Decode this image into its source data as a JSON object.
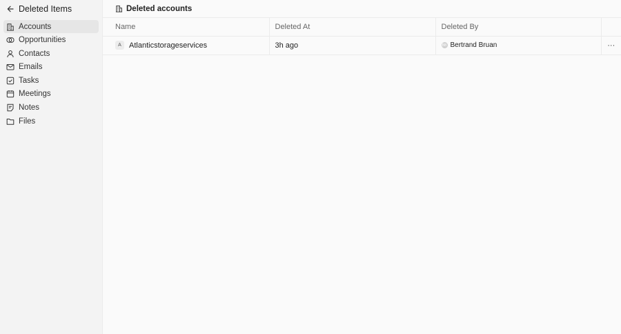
{
  "sidebar": {
    "title": "Deleted Items",
    "back_icon": "arrow-left-icon",
    "items": [
      {
        "label": "Accounts",
        "icon": "building-icon",
        "active": true
      },
      {
        "label": "Opportunities",
        "icon": "target-icon"
      },
      {
        "label": "Contacts",
        "icon": "user-icon"
      },
      {
        "label": "Emails",
        "icon": "mail-icon"
      },
      {
        "label": "Tasks",
        "icon": "checkbox-icon"
      },
      {
        "label": "Meetings",
        "icon": "calendar-icon"
      },
      {
        "label": "Notes",
        "icon": "note-icon"
      },
      {
        "label": "Files",
        "icon": "folder-icon"
      }
    ]
  },
  "header": {
    "title": "Deleted accounts",
    "icon": "building-icon"
  },
  "table": {
    "columns": [
      "Name",
      "Deleted At",
      "Deleted By"
    ],
    "rows": [
      {
        "badge": "A",
        "name": "Atlanticstorageservices",
        "deleted_at": "3h ago",
        "avatar": "BB",
        "deleted_by": "Bertrand Bruan",
        "more": "···"
      }
    ]
  }
}
